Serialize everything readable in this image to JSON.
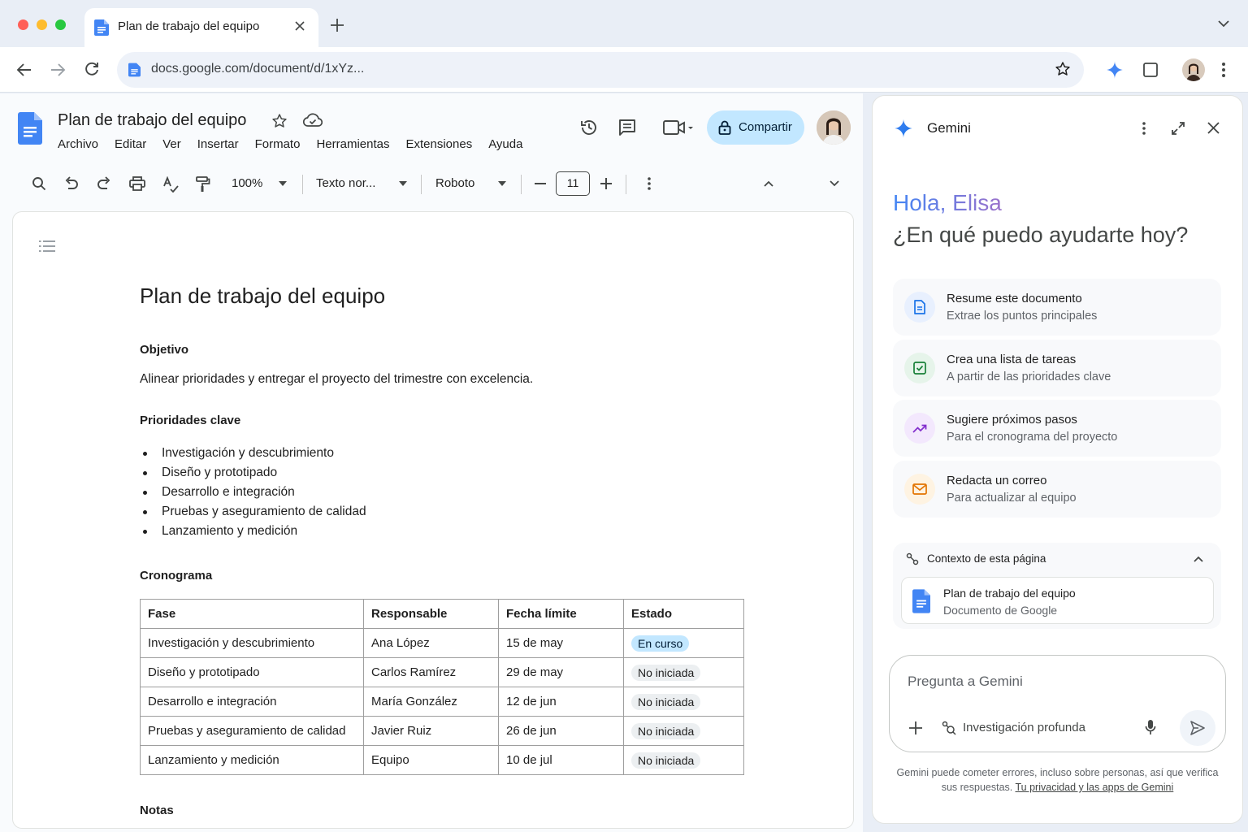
{
  "browser": {
    "tab_title": "Plan de trabajo del equipo",
    "url": "docs.google.com/document/d/1xYz..."
  },
  "docs": {
    "title": "Plan de trabajo del equipo",
    "menus": [
      "Archivo",
      "Editar",
      "Ver",
      "Insertar",
      "Formato",
      "Herramientas",
      "Extensiones",
      "Ayuda"
    ],
    "share_label": "Compartir",
    "toolbar": {
      "zoom": "100%",
      "style": "Texto nor...",
      "font": "Roboto",
      "font_size": "11"
    }
  },
  "document": {
    "heading": "Plan de trabajo del equipo",
    "objective_title": "Objetivo",
    "objective_text": "Alinear prioridades y entregar el proyecto del trimestre con excelencia.",
    "priorities_title": "Prioridades clave",
    "priorities": [
      "Investigación y descubrimiento",
      "Diseño y prototipado",
      "Desarrollo e integración",
      "Pruebas y aseguramiento de calidad",
      "Lanzamiento y medición"
    ],
    "timeline_title": "Cronograma",
    "table": {
      "headers": [
        "Fase",
        "Responsable",
        "Fecha límite",
        "Estado"
      ],
      "rows": [
        [
          "Investigación y descubrimiento",
          "Ana López",
          "15 de may",
          "En curso"
        ],
        [
          "Diseño y prototipado",
          "Carlos Ramírez",
          "29 de may",
          "No iniciada"
        ],
        [
          "Desarrollo e integración",
          "María González",
          "12 de jun",
          "No iniciada"
        ],
        [
          "Pruebas y aseguramiento de calidad",
          "Javier Ruiz",
          "26 de jun",
          "No iniciada"
        ],
        [
          "Lanzamiento y medición",
          "Equipo",
          "10 de jul",
          "No iniciada"
        ]
      ]
    },
    "notes_title": "Notas"
  },
  "gemini": {
    "title": "Gemini",
    "greeting": "Hola, Elisa",
    "question": "¿En qué puedo ayudarte hoy?",
    "suggestions": [
      {
        "title": "Resume este documento",
        "subtitle": "Extrae los puntos principales",
        "icon": "document-icon",
        "color": "#1a73e8",
        "bg": "#e8f0fe"
      },
      {
        "title": "Crea una lista de tareas",
        "subtitle": "A partir de las prioridades clave",
        "icon": "checkbox-icon",
        "color": "#188038",
        "bg": "#e6f4ea"
      },
      {
        "title": "Sugiere próximos pasos",
        "subtitle": "Para el cronograma del proyecto",
        "icon": "trending-icon",
        "color": "#8430ce",
        "bg": "#f3e8fd"
      },
      {
        "title": "Redacta un correo",
        "subtitle": "Para actualizar al equipo",
        "icon": "mail-icon",
        "color": "#e37400",
        "bg": "#fef3e2"
      }
    ],
    "context_label": "Contexto de esta página",
    "context_doc_title": "Plan de trabajo del equipo",
    "context_doc_type": "Documento de Google",
    "prompt_placeholder": "Pregunta a Gemini",
    "deep_research": "Investigación profunda",
    "disclaimer": "Gemini puede cometer errores, incluso sobre personas, así que verifica sus respuestas.",
    "privacy_link": "Tu privacidad y las apps de Gemini"
  }
}
